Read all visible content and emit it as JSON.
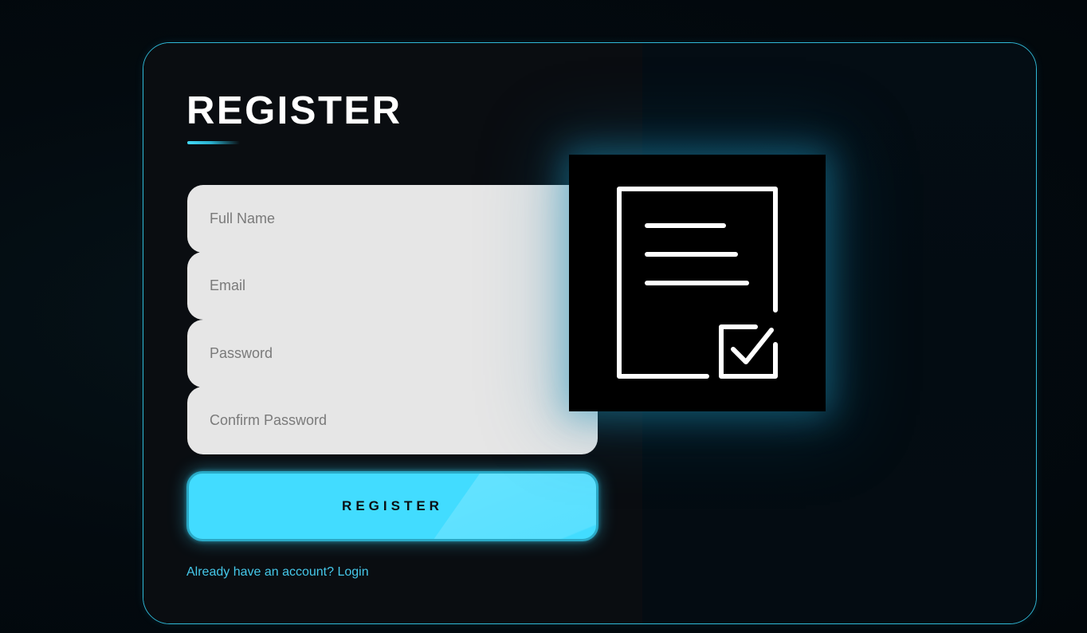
{
  "form": {
    "title": "REGISTER",
    "fields": [
      {
        "placeholder": "Full Name",
        "value": ""
      },
      {
        "placeholder": "Email",
        "value": ""
      },
      {
        "placeholder": "Password",
        "value": ""
      },
      {
        "placeholder": "Confirm Password",
        "value": ""
      }
    ],
    "submit_label": "REGISTER",
    "login_link": "Already have an account? Login"
  },
  "illustration": {
    "icon": "document-check-icon"
  },
  "colors": {
    "accent": "#42dcff",
    "accent_border": "#2fb8d6",
    "link": "#45c8ea",
    "field_bg": "#e6e6e6",
    "card_bg": "#0a0d11",
    "page_bg": "#030b10"
  }
}
